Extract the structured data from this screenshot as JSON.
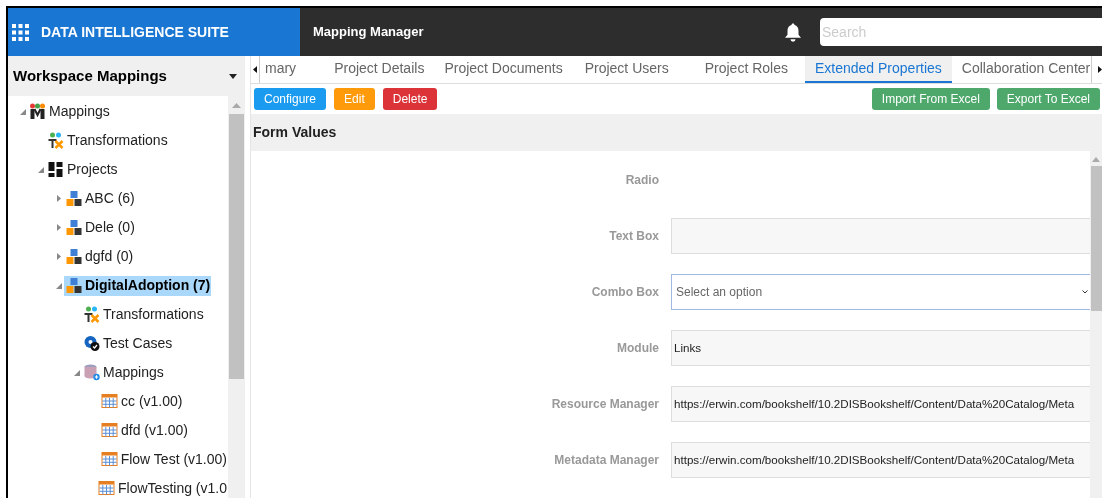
{
  "header": {
    "app_title": "DATA INTELLIGENCE SUITE",
    "module_title": "Mapping Manager",
    "search": {
      "placeholder": "Search"
    }
  },
  "sidebar": {
    "title": "Workspace Mappings",
    "tree": [
      {
        "label": "Mappings",
        "kind": "mappings-root",
        "expanded": true,
        "selected": false,
        "children": [
          {
            "label": "Transformations",
            "kind": "transformations",
            "selected": false
          },
          {
            "label": "Projects",
            "kind": "projects",
            "expanded": true,
            "selected": false,
            "children": [
              {
                "label": "ABC (6)",
                "kind": "project",
                "expanded": false,
                "selected": false
              },
              {
                "label": "Dele (0)",
                "kind": "project",
                "expanded": false,
                "selected": false
              },
              {
                "label": "dgfd (0)",
                "kind": "project",
                "expanded": false,
                "selected": false
              },
              {
                "label": "DigitalAdoption (7)",
                "kind": "project",
                "expanded": true,
                "selected": true,
                "children": [
                  {
                    "label": "Transformations",
                    "kind": "transformations",
                    "selected": false
                  },
                  {
                    "label": "Test Cases",
                    "kind": "test-cases",
                    "selected": false
                  },
                  {
                    "label": "Mappings",
                    "kind": "mappings-folder",
                    "expanded": true,
                    "selected": false,
                    "children": [
                      {
                        "label": "cc (v1.00)",
                        "kind": "mapping",
                        "selected": false
                      },
                      {
                        "label": "dfd (v1.00)",
                        "kind": "mapping",
                        "selected": false
                      },
                      {
                        "label": "Flow Test (v1.00)",
                        "kind": "mapping",
                        "selected": false
                      },
                      {
                        "label": "FlowTesting (v1.0",
                        "kind": "mapping",
                        "selected": false
                      }
                    ]
                  }
                ]
              }
            ]
          }
        ]
      }
    ]
  },
  "tabs": [
    {
      "label": "mary",
      "selected": false
    },
    {
      "label": "Project Details",
      "selected": false
    },
    {
      "label": "Project Documents",
      "selected": false
    },
    {
      "label": "Project Users",
      "selected": false
    },
    {
      "label": "Project Roles",
      "selected": false
    },
    {
      "label": "Extended Properties",
      "selected": true
    },
    {
      "label": "Collaboration Center",
      "selected": false
    }
  ],
  "toolbar": {
    "left_buttons": [
      {
        "label": "Configure",
        "kind": "primary"
      },
      {
        "label": "Edit",
        "kind": "warning"
      },
      {
        "label": "Delete",
        "kind": "danger"
      }
    ],
    "right_buttons": [
      {
        "label": "Import From Excel",
        "kind": "success"
      },
      {
        "label": "Export To Excel",
        "kind": "success"
      }
    ]
  },
  "form": {
    "title": "Form Values",
    "fields": [
      {
        "label": "Radio",
        "kind": "radio"
      },
      {
        "label": "Text Box",
        "kind": "text"
      },
      {
        "label": "Combo Box",
        "kind": "select",
        "placeholder": "Select an option"
      },
      {
        "label": "Module",
        "kind": "text",
        "value": "Links"
      },
      {
        "label": "Resource Manager",
        "kind": "text",
        "value": "https://erwin.com/bookshelf/10.2DISBookshelf/Content/Data%20Catalog/Meta"
      },
      {
        "label": "Metadata Manager",
        "kind": "text",
        "value": "https://erwin.com/bookshelf/10.2DISBookshelf/Content/Data%20Catalog/Meta"
      }
    ]
  }
}
